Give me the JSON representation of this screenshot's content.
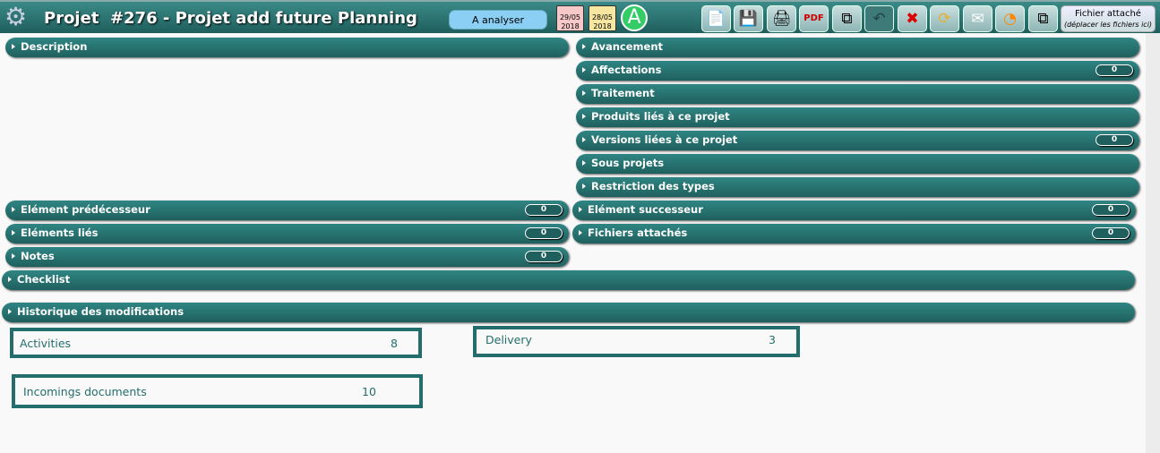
{
  "header": {
    "title": "Projet  #276 - Projet add future Planning",
    "status": "A analyser",
    "cal1": {
      "date": "29/05",
      "year": "2018"
    },
    "cal2": {
      "date": "28/05",
      "year": "2018"
    },
    "avatar": "A",
    "fichier_title": "Fichier attaché",
    "fichier_hint": "(déplacer les fichiers ici)"
  },
  "toolbar": [
    "new-icon",
    "save-icon",
    "print-icon",
    "pdf-icon",
    "copy-icon",
    "undo-icon",
    "delete-icon",
    "refresh-icon",
    "mail-icon",
    "rss-icon",
    "multi-save-icon"
  ],
  "sections": {
    "description": "Description",
    "avancement": "Avancement",
    "affectations": "Affectations",
    "affectations_count": "0",
    "traitement": "Traitement",
    "produits": "Produits liés à ce projet",
    "versions": "Versions liées à ce projet",
    "versions_count": "0",
    "sous_projets": "Sous projets",
    "restriction": "Restriction des types",
    "predecesseur": "Elément prédécesseur",
    "predecesseur_count": "0",
    "successeur": "Elément successeur",
    "successeur_count": "0",
    "lies": "Eléments liés",
    "lies_count": "0",
    "fichiers": "Fichiers attachés",
    "fichiers_count": "0",
    "notes": "Notes",
    "notes_count": "0",
    "checklist": "Checklist",
    "historique": "Historique des modifications"
  },
  "counters": [
    {
      "label": "Activities",
      "value": "8"
    },
    {
      "label": "Delivery",
      "value": "3"
    },
    {
      "label": "Incomings documents",
      "value": "10"
    }
  ]
}
